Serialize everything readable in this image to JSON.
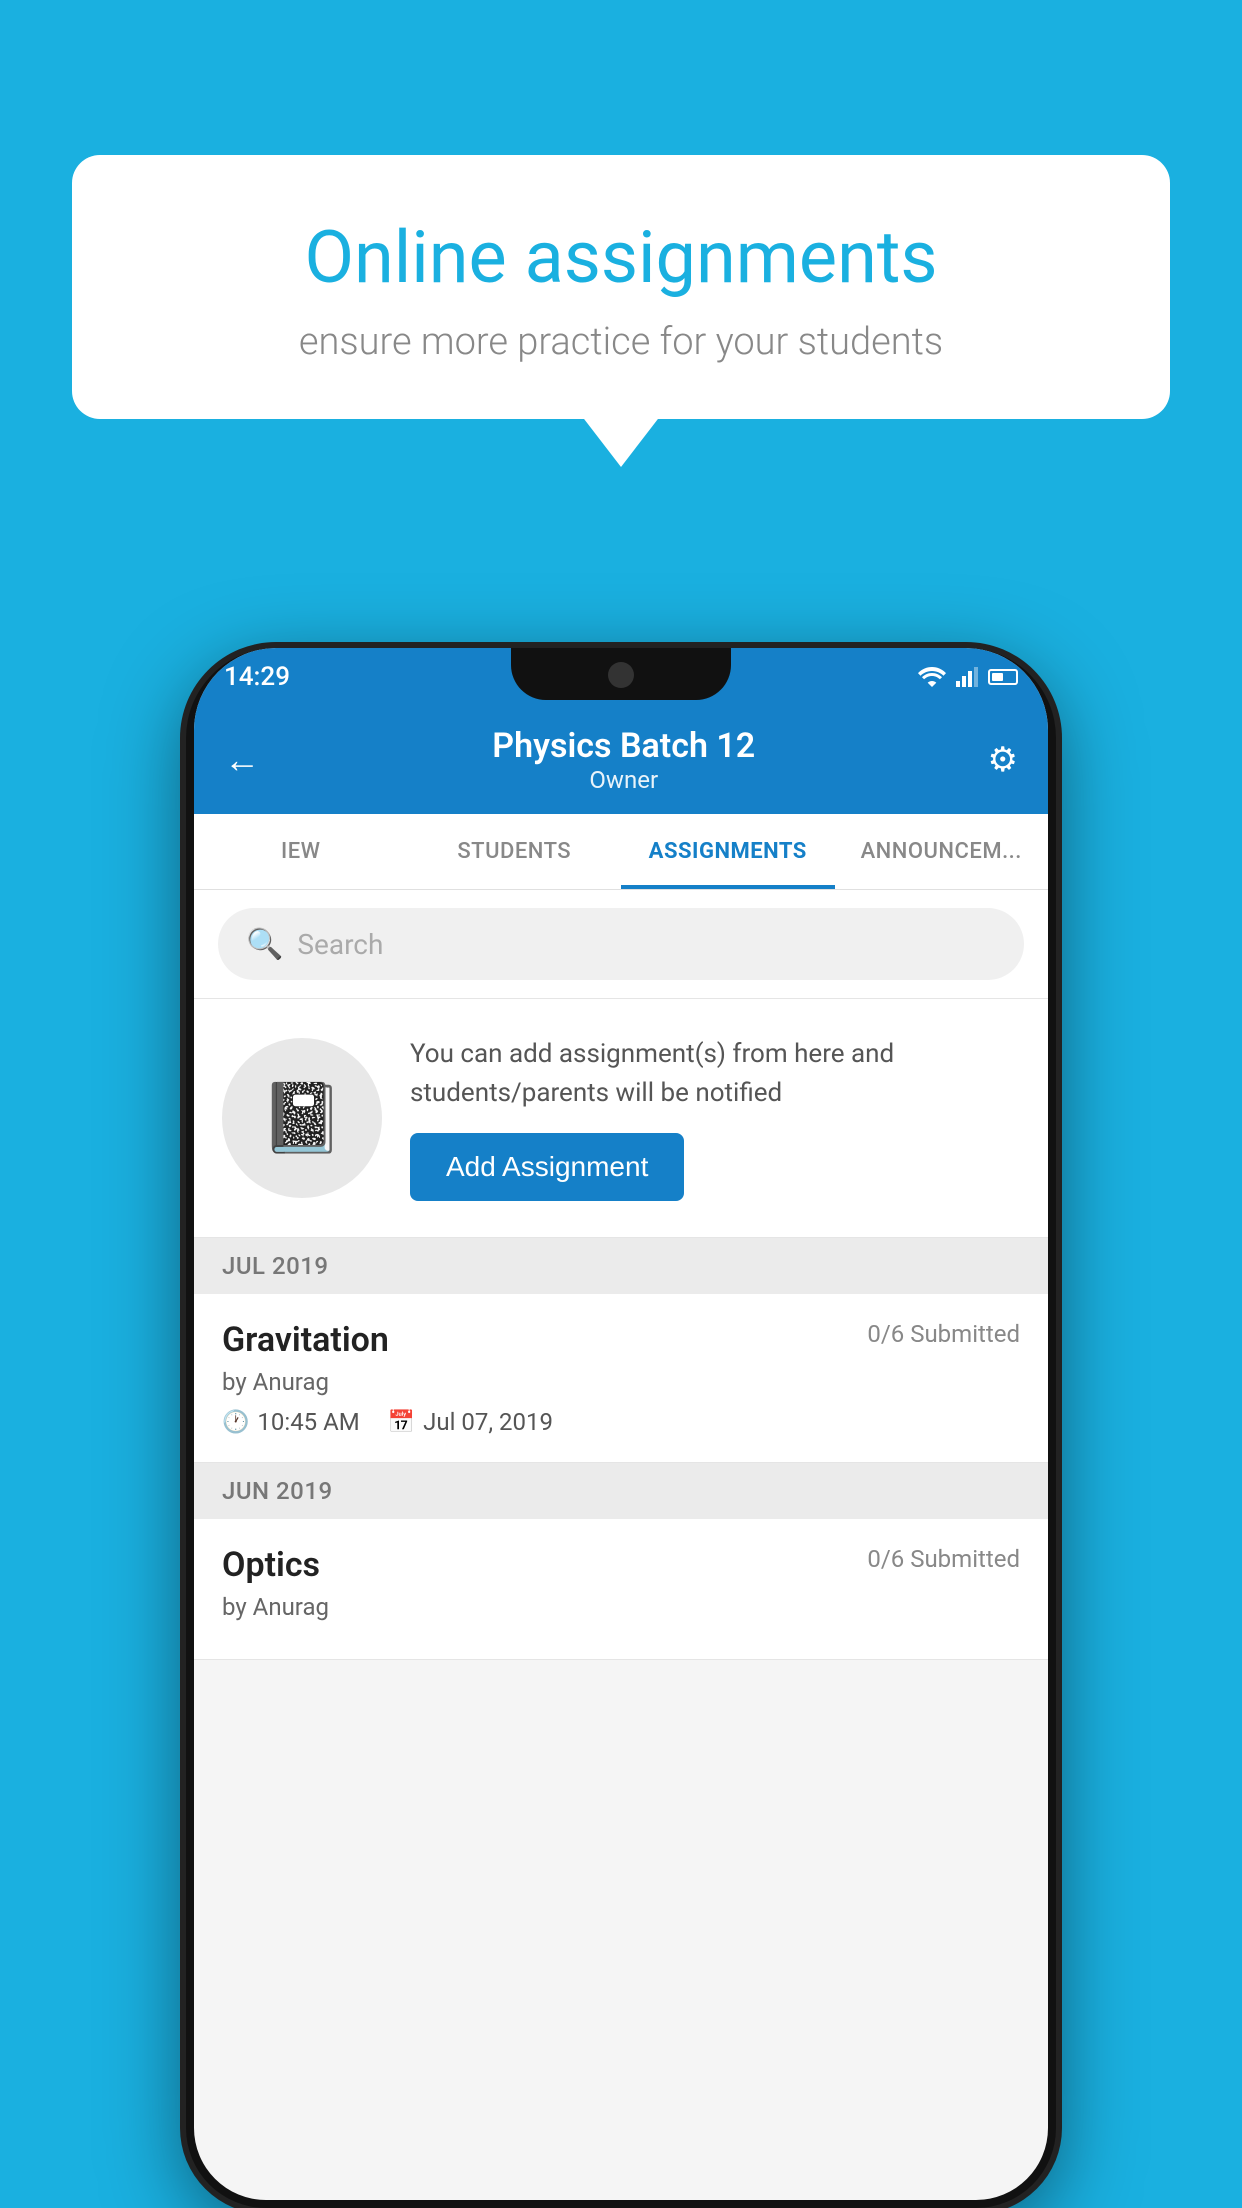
{
  "background_color": "#1ab0e0",
  "speech_bubble": {
    "title": "Online assignments",
    "subtitle": "ensure more practice for your students"
  },
  "status_bar": {
    "time": "14:29",
    "wifi_icon": "wifi",
    "signal_icon": "signal",
    "battery_icon": "battery"
  },
  "app_header": {
    "title": "Physics Batch 12",
    "subtitle": "Owner",
    "back_label": "←",
    "settings_icon": "⚙"
  },
  "tabs": [
    {
      "label": "IEW",
      "active": false
    },
    {
      "label": "STUDENTS",
      "active": false
    },
    {
      "label": "ASSIGNMENTS",
      "active": true
    },
    {
      "label": "ANNOUNCEM...",
      "active": false
    }
  ],
  "search": {
    "placeholder": "Search"
  },
  "promo": {
    "description": "You can add assignment(s) from here and students/parents will be notified",
    "button_label": "Add Assignment"
  },
  "sections": [
    {
      "month_label": "JUL 2019",
      "assignments": [
        {
          "title": "Gravitation",
          "submitted": "0/6 Submitted",
          "author": "by Anurag",
          "time": "10:45 AM",
          "date": "Jul 07, 2019"
        }
      ]
    },
    {
      "month_label": "JUN 2019",
      "assignments": [
        {
          "title": "Optics",
          "submitted": "0/6 Submitted",
          "author": "by Anurag",
          "time": "",
          "date": ""
        }
      ]
    }
  ]
}
